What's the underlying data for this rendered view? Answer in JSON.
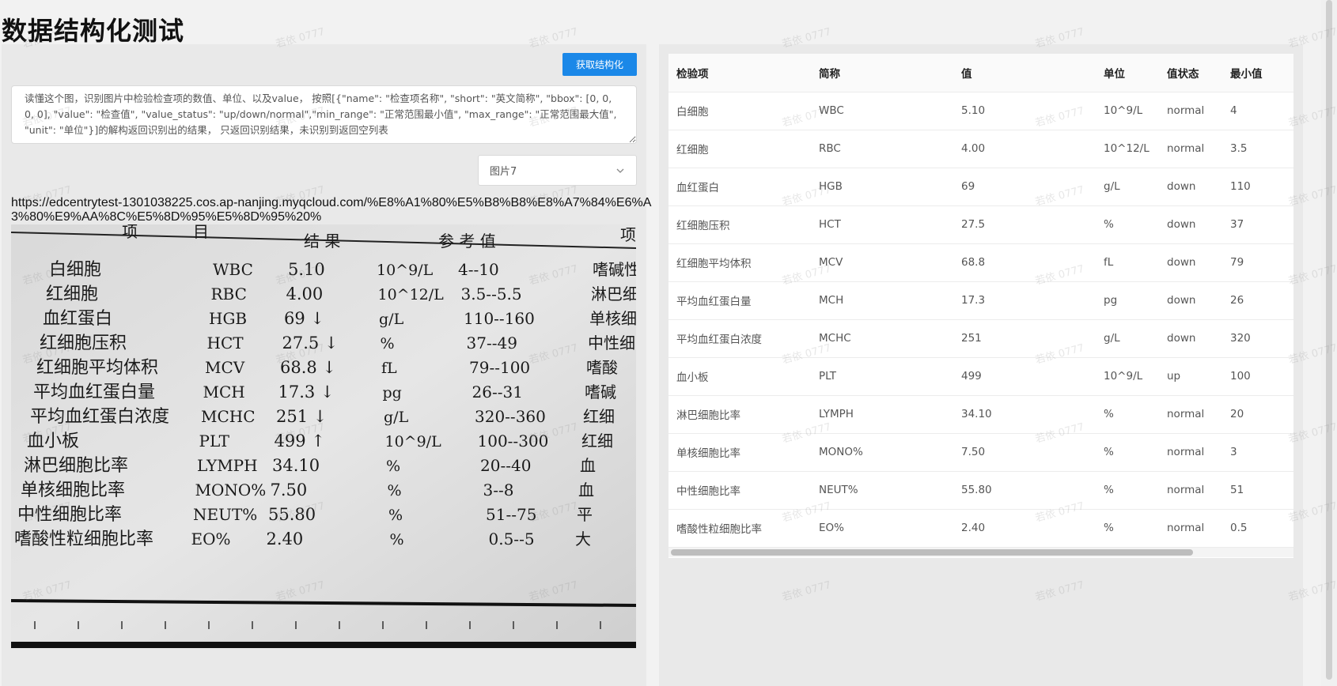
{
  "page": {
    "title": "数据结构化测试"
  },
  "controls": {
    "fetch_button_label": "获取结构化",
    "prompt_text": "读懂这个图，识别图片中检验检查项的数值、单位、以及value， 按照[{\"name\": \"检查项名称\", \"short\": \"英文简称\", \"bbox\": [0, 0, 0, 0], \"value\": \"检查值\", \"value_status\": \"up/down/normal\",\"min_range\": \"正常范围最小值\", \"max_range\": \"正常范围最大值\", \"unit\": \"单位\"}]的解构返回识别出的结果， 只返回识别结果，未识别到返回空列表",
    "image_select_value": "图片7",
    "image_url": "https://edcentrytest-1301038225.cos.ap-nanjing.myqcloud.com/%E8%A1%80%E5%B8%B8%E8%A7%84%E6%A3%80%E9%AA%8C%E5%8D%95%E5%8D%95%20%"
  },
  "report_image": {
    "headers": [
      "项",
      "目",
      "结 果",
      "参 考 值",
      "项"
    ],
    "rows": [
      {
        "name": "白细胞",
        "short": "WBC",
        "value": "5.10",
        "unit": "10^9/L",
        "range": "4--10",
        "right": "嗜碱性"
      },
      {
        "name": "红细胞",
        "short": "RBC",
        "value": "4.00",
        "unit": "10^12/L",
        "range": "3.5--5.5",
        "right": "淋巴细"
      },
      {
        "name": "血红蛋白",
        "short": "HGB",
        "value": "69 ↓",
        "unit": "g/L",
        "range": "110--160",
        "right": "单核细"
      },
      {
        "name": "红细胞压积",
        "short": "HCT",
        "value": "27.5 ↓",
        "unit": "%",
        "range": "37--49",
        "right": "中性细"
      },
      {
        "name": "红细胞平均体积",
        "short": "MCV",
        "value": "68.8 ↓",
        "unit": "fL",
        "range": "79--100",
        "right": "嗜酸"
      },
      {
        "name": "平均血红蛋白量",
        "short": "MCH",
        "value": "17.3 ↓",
        "unit": "pg",
        "range": "26--31",
        "right": "嗜碱"
      },
      {
        "name": "平均血红蛋白浓度",
        "short": "MCHC",
        "value": "251 ↓",
        "unit": "g/L",
        "range": "320--360",
        "right": "红细"
      },
      {
        "name": "血小板",
        "short": "PLT",
        "value": "499 ↑",
        "unit": "10^9/L",
        "range": "100--300",
        "right": "红细"
      },
      {
        "name": "淋巴细胞比率",
        "short": "LYMPH",
        "value": "34.10",
        "unit": "%",
        "range": "20--40",
        "right": "血"
      },
      {
        "name": "单核细胞比率",
        "short": "MONO%",
        "value": "7.50",
        "unit": "%",
        "range": "3--8",
        "right": "血"
      },
      {
        "name": "中性细胞比率",
        "short": "NEUT%",
        "value": "55.80",
        "unit": "%",
        "range": "51--75",
        "right": "平"
      },
      {
        "name": "嗜酸性粒细胞比率",
        "short": "EO%",
        "value": "2.40",
        "unit": "%",
        "range": "0.5--5",
        "right": "大"
      }
    ]
  },
  "table": {
    "headers": [
      "检验项",
      "简称",
      "值",
      "单位",
      "值状态",
      "最小值"
    ],
    "rows": [
      [
        "白细胞",
        "WBC",
        "5.10",
        "10^9/L",
        "normal",
        "4"
      ],
      [
        "红细胞",
        "RBC",
        "4.00",
        "10^12/L",
        "normal",
        "3.5"
      ],
      [
        "血红蛋白",
        "HGB",
        "69",
        "g/L",
        "down",
        "110"
      ],
      [
        "红细胞压积",
        "HCT",
        "27.5",
        "%",
        "down",
        "37"
      ],
      [
        "红细胞平均体积",
        "MCV",
        "68.8",
        "fL",
        "down",
        "79"
      ],
      [
        "平均血红蛋白量",
        "MCH",
        "17.3",
        "pg",
        "down",
        "26"
      ],
      [
        "平均血红蛋白浓度",
        "MCHC",
        "251",
        "g/L",
        "down",
        "320"
      ],
      [
        "血小板",
        "PLT",
        "499",
        "10^9/L",
        "up",
        "100"
      ],
      [
        "淋巴细胞比率",
        "LYMPH",
        "34.10",
        "%",
        "normal",
        "20"
      ],
      [
        "单核细胞比率",
        "MONO%",
        "7.50",
        "%",
        "normal",
        "3"
      ],
      [
        "中性细胞比率",
        "NEUT%",
        "55.80",
        "%",
        "normal",
        "51"
      ],
      [
        "嗜酸性粒细胞比率",
        "EO%",
        "2.40",
        "%",
        "normal",
        "0.5"
      ]
    ]
  },
  "watermark": {
    "text": "若依 0777"
  },
  "colors": {
    "primary_button": "#1b88e8",
    "panel_bg": "#e9e9e9",
    "page_bg": "#f2f2f2"
  }
}
